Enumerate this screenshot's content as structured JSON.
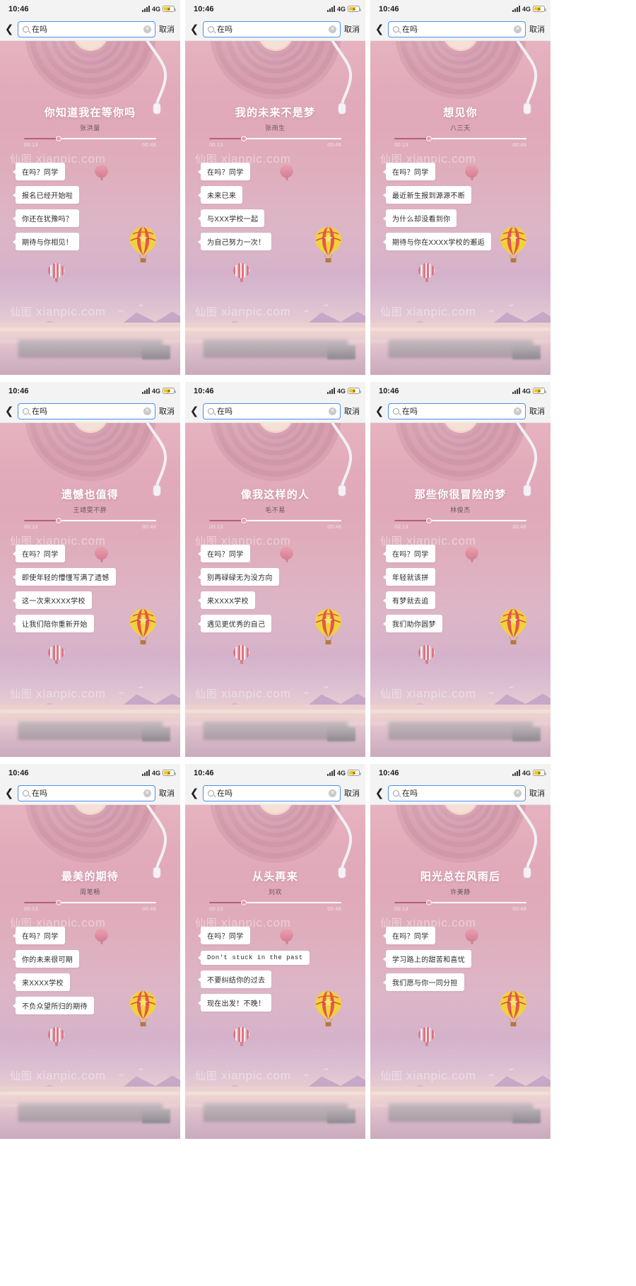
{
  "statusbar": {
    "time": "10:46",
    "network": "4G",
    "signal_icon": "signal-bars-icon",
    "battery_icon": "battery-charging-icon"
  },
  "searchbar": {
    "back_icon": "back-chevron-icon",
    "search_icon": "search-icon",
    "query": "在吗",
    "clear_icon": "clear-circle-icon",
    "clear_glyph": "✕",
    "cancel_label": "取消"
  },
  "player": {
    "elapsed": "00:13",
    "duration": "00:48",
    "progress_percent": 26
  },
  "watermark": {
    "cn": "仙图",
    "en": "xianpic.com"
  },
  "colors": {
    "accent": "#b4607e",
    "search_border": "#4a90f5",
    "battery": "#f5c518",
    "bubble_bg": "#ffffff"
  },
  "panels": [
    {
      "id": "panel-1",
      "title": "你知道我在等你吗",
      "artist": "张洪量",
      "bubbles": [
        "在吗？同学",
        "报名已经开始啦",
        "你还在犹豫吗？",
        "期待与你相见！"
      ]
    },
    {
      "id": "panel-2",
      "title": "我的未来不是梦",
      "artist": "张雨生",
      "bubbles": [
        "在吗？同学",
        "未来已来",
        "与XXX学校一起",
        "为自己努力一次！"
      ]
    },
    {
      "id": "panel-3",
      "title": "想见你",
      "artist": "八三夭",
      "bubbles": [
        "在吗？同学",
        "最近新生报到源源不断",
        "为什么却没看到你",
        "期待与你在XXXX学校的邂逅"
      ]
    },
    {
      "id": "panel-4",
      "title": "遗憾也值得",
      "artist": "王靖雯不胖",
      "bubbles": [
        "在吗？同学",
        "即使年轻的懵懂写满了遗憾",
        "这一次来XXXX学校",
        "让我们陪你重新开始"
      ]
    },
    {
      "id": "panel-5",
      "title": "像我这样的人",
      "artist": "毛不易",
      "bubbles": [
        "在吗？同学",
        "别再碌碌无为没方向",
        "来XXXX学校",
        "遇见更优秀的自己"
      ]
    },
    {
      "id": "panel-6",
      "title": "那些你很冒险的梦",
      "artist": "林俊杰",
      "bubbles": [
        "在吗？同学",
        "年轻就该拼",
        "有梦就去追",
        "我们助你圆梦"
      ]
    },
    {
      "id": "panel-7",
      "title": "最美的期待",
      "artist": "周笔畅",
      "bubbles": [
        "在吗？同学",
        "你的未来很可期",
        "来XXXX学校",
        "不负众望所归的期待"
      ]
    },
    {
      "id": "panel-8",
      "title": "从头再来",
      "artist": "刘欢",
      "bubbles": [
        "在吗？同学",
        "Don't stuck in the past",
        "不要纠结你的过去",
        "现在出发！不晚！"
      ],
      "mono_index": 1
    },
    {
      "id": "panel-9",
      "title": "阳光总在风雨后",
      "artist": "许美静",
      "bubbles": [
        "在吗？同学",
        "学习路上的甜苦和喜忧",
        "我们愿与你一同分担"
      ]
    }
  ]
}
